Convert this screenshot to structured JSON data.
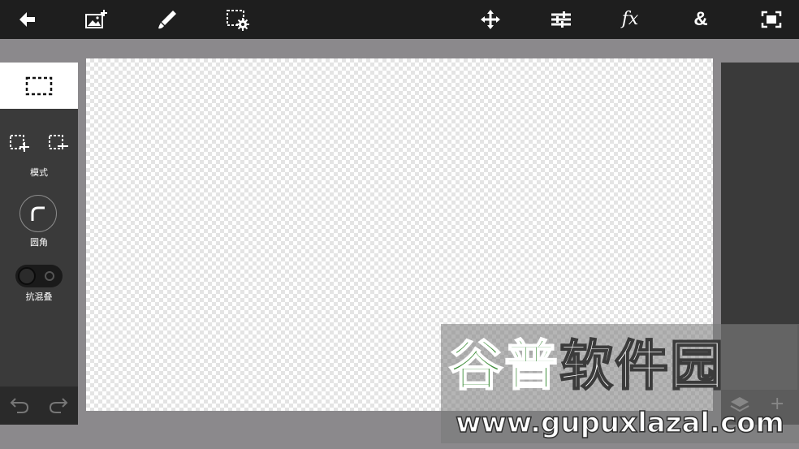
{
  "toolbar": {
    "items": [
      {
        "name": "back",
        "icon": "arrow-left-icon"
      },
      {
        "name": "add-image",
        "icon": "add-image-icon"
      },
      {
        "name": "brush",
        "icon": "brush-icon"
      },
      {
        "name": "selection-settings",
        "icon": "selection-settings-icon"
      },
      {
        "name": "move",
        "icon": "move-arrows-icon"
      },
      {
        "name": "adjustments",
        "icon": "sliders-icon"
      },
      {
        "name": "effects",
        "icon": "fx-icon",
        "label": "fx"
      },
      {
        "name": "blend",
        "icon": "ampersand-icon",
        "label": "&"
      },
      {
        "name": "fit-screen",
        "icon": "fit-screen-icon"
      }
    ]
  },
  "left_panel": {
    "mode_label": "模式",
    "rounded_label": "圆角",
    "antialias_label": "抗混叠",
    "antialias_on": false
  },
  "right_panel": {
    "add_label": "+"
  },
  "watermark": {
    "title_green": "谷普",
    "title_white": "软件园",
    "url": "www.gupuxlazal.com"
  },
  "colors": {
    "toolbar_bg": "#1e1e1e",
    "workspace_bg": "#8b898c",
    "panel_bg": "#3a3a3a",
    "watermark_green": "#3f8e3b"
  }
}
